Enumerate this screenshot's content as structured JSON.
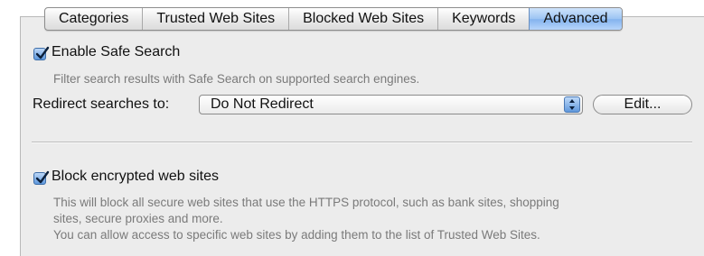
{
  "tabs": [
    {
      "label": "Categories",
      "active": false
    },
    {
      "label": "Trusted Web Sites",
      "active": false
    },
    {
      "label": "Blocked Web Sites",
      "active": false
    },
    {
      "label": "Keywords",
      "active": false
    },
    {
      "label": "Advanced",
      "active": true
    }
  ],
  "safe_search": {
    "label": "Enable Safe Search",
    "checked": true,
    "description": "Filter search results with Safe Search on supported search engines."
  },
  "redirect": {
    "label": "Redirect searches to:",
    "selected": "Do Not Redirect",
    "edit_button": "Edit..."
  },
  "block_encrypted": {
    "label": "Block encrypted web sites",
    "checked": true,
    "description_lines": [
      "This will block all secure web sites that use the HTTPS protocol, such as bank sites, shopping",
      "sites, secure proxies and more.",
      "You can allow access to specific web sites by adding them to the list of Trusted Web Sites."
    ]
  },
  "colors": {
    "accent": "#83b3ee",
    "panel_bg": "#ececec",
    "muted_text": "#7a7a7a"
  }
}
